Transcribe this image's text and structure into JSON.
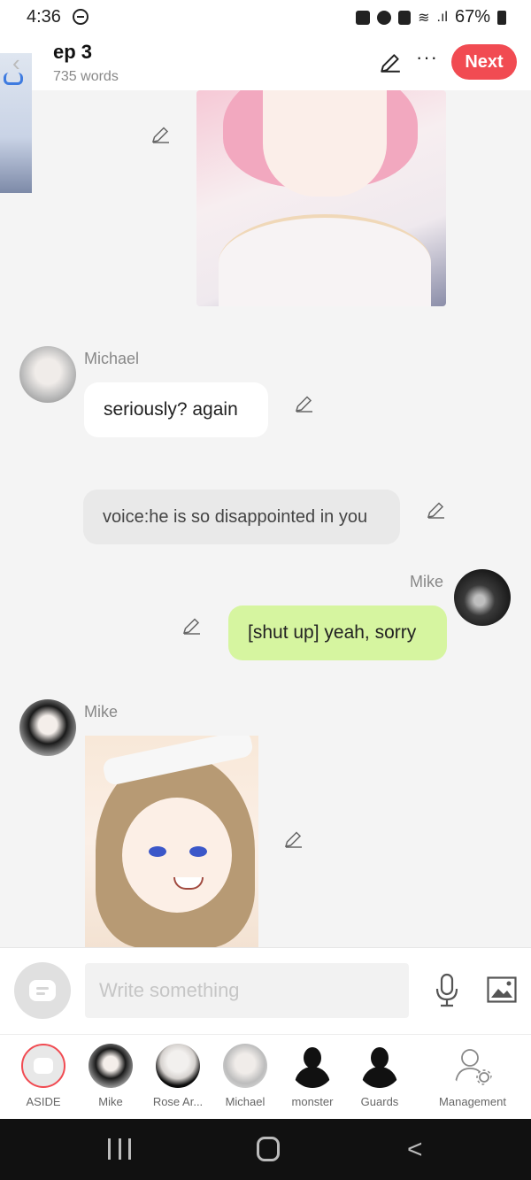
{
  "status_bar": {
    "time": "4:36",
    "battery": "67%"
  },
  "header": {
    "back_chevron": "‹",
    "title": "ep 3",
    "word_count": "735 words",
    "more_label": "···",
    "next_label": "Next"
  },
  "messages": [
    {
      "type": "image",
      "side": "right",
      "description_icon": "image"
    },
    {
      "type": "text",
      "side": "left",
      "speaker": "Michael",
      "text": "seriously? again"
    },
    {
      "type": "aside",
      "text": "voice:he is so disappointed in you"
    },
    {
      "type": "text",
      "side": "right",
      "speaker": "Mike",
      "text": "[shut up] yeah, sorry"
    },
    {
      "type": "image",
      "side": "left",
      "speaker": "Mike"
    }
  ],
  "composer": {
    "placeholder": "Write something"
  },
  "roles": [
    {
      "label": "ASIDE"
    },
    {
      "label": "Mike"
    },
    {
      "label": "Rose Ar..."
    },
    {
      "label": "Michael"
    },
    {
      "label": "monster"
    },
    {
      "label": "Guards"
    },
    {
      "label": "Management"
    }
  ],
  "colors": {
    "accent": "#f14b52",
    "bubble_green": "#d6f5a0",
    "aside_bubble": "#e9e9e9"
  },
  "icons": {
    "edit": "pencil-icon",
    "mic": "microphone-icon",
    "image": "image-icon",
    "settings": "management-icon"
  }
}
